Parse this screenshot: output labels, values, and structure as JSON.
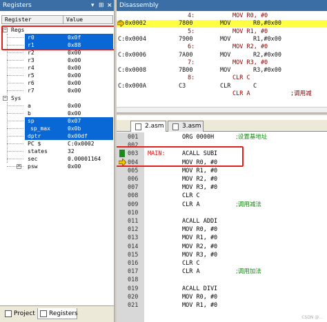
{
  "registers_pane": {
    "title": "Registers",
    "title_controls": [
      "▾",
      "⊞",
      "×"
    ],
    "header": {
      "col1": "Register",
      "col2": "Value"
    },
    "rows": [
      {
        "name": "Regs",
        "value": "",
        "expander": "−",
        "group": true
      },
      {
        "name": "r0",
        "value": "0x0f",
        "selected": true
      },
      {
        "name": "r1",
        "value": "0x88",
        "selected": true
      },
      {
        "name": "r2",
        "value": "0x00"
      },
      {
        "name": "r3",
        "value": "0x00"
      },
      {
        "name": "r4",
        "value": "0x00"
      },
      {
        "name": "r5",
        "value": "0x00"
      },
      {
        "name": "r6",
        "value": "0x00"
      },
      {
        "name": "r7",
        "value": "0x00"
      },
      {
        "name": "Sys",
        "value": "",
        "expander": "−",
        "group": true
      },
      {
        "name": "a",
        "value": "0x00"
      },
      {
        "name": "b",
        "value": "0x00"
      },
      {
        "name": "sp",
        "value": "0x07",
        "selected": true
      },
      {
        "name": "sp_max",
        "value": "0x0b",
        "selected": true
      },
      {
        "name": "dptr",
        "value": "0x00df",
        "selected": true
      },
      {
        "name": "PC  $",
        "value": "C:0x0002"
      },
      {
        "name": "states",
        "value": "32"
      },
      {
        "name": "sec",
        "value": "0.00001164"
      },
      {
        "name": "psw",
        "value": "0x00",
        "expander": "+"
      }
    ],
    "bottom_tabs": [
      {
        "label": "Project"
      },
      {
        "label": "Registers"
      }
    ]
  },
  "disassembly_pane": {
    "title": "Disassembly",
    "lines": [
      {
        "kind": "src",
        "num": "4:",
        "text": "MOV R0, #0"
      },
      {
        "kind": "asm",
        "addr": "C:0x0002",
        "op": "7800",
        "mn": "MOV",
        "args": "R0,#0x00",
        "current": true
      },
      {
        "kind": "src",
        "num": "5:",
        "text": "MOV R1, #0"
      },
      {
        "kind": "asm",
        "addr": "C:0x0004",
        "op": "7900",
        "mn": "MOV",
        "args": "R1,#0x00"
      },
      {
        "kind": "src",
        "num": "6:",
        "text": "MOV R2, #0"
      },
      {
        "kind": "asm",
        "addr": "C:0x0006",
        "op": "7A00",
        "mn": "MOV",
        "args": "R2,#0x00"
      },
      {
        "kind": "src",
        "num": "7:",
        "text": "MOV R3, #0"
      },
      {
        "kind": "asm",
        "addr": "C:0x0008",
        "op": "7B00",
        "mn": "MOV",
        "args": "R3,#0x00"
      },
      {
        "kind": "src",
        "num": "8:",
        "text": "CLR C"
      },
      {
        "kind": "asm",
        "addr": "C:0x000A",
        "op": "C3",
        "mn": "CLR",
        "args": "C"
      },
      {
        "kind": "src",
        "num": "",
        "text": "CLR A",
        "comment": ";调用减"
      }
    ]
  },
  "editor_pane": {
    "tabs": [
      {
        "label": "2.asm",
        "active": true
      },
      {
        "label": "3.asm",
        "active": false
      }
    ],
    "lines": [
      {
        "num": "001",
        "label": "",
        "code": "ORG 0000H",
        "comment": ";设置基地址"
      },
      {
        "num": "002",
        "label": "",
        "code": "",
        "comment": ""
      },
      {
        "num": "003",
        "label": "MAIN:",
        "code": "ACALL SUBI",
        "comment": "",
        "breakpoint": true
      },
      {
        "num": "004",
        "label": "",
        "code": "MOV R0, #0",
        "comment": "",
        "current": true
      },
      {
        "num": "005",
        "label": "",
        "code": "MOV R1, #0",
        "comment": ""
      },
      {
        "num": "006",
        "label": "",
        "code": "MOV R2, #0",
        "comment": ""
      },
      {
        "num": "007",
        "label": "",
        "code": "MOV R3, #0",
        "comment": ""
      },
      {
        "num": "008",
        "label": "",
        "code": "CLR C",
        "comment": ""
      },
      {
        "num": "009",
        "label": "",
        "code": "CLR A",
        "comment": ";调用减法"
      },
      {
        "num": "010",
        "label": "",
        "code": "",
        "comment": ""
      },
      {
        "num": "011",
        "label": "",
        "code": "ACALL ADDI",
        "comment": ""
      },
      {
        "num": "012",
        "label": "",
        "code": "MOV R0, #0",
        "comment": ""
      },
      {
        "num": "013",
        "label": "",
        "code": "MOV R1, #0",
        "comment": ""
      },
      {
        "num": "014",
        "label": "",
        "code": "MOV R2, #0",
        "comment": ""
      },
      {
        "num": "015",
        "label": "",
        "code": "MOV R3, #0",
        "comment": ""
      },
      {
        "num": "016",
        "label": "",
        "code": "CLR C",
        "comment": ""
      },
      {
        "num": "017",
        "label": "",
        "code": "CLR A",
        "comment": ";调用加法"
      },
      {
        "num": "018",
        "label": "",
        "code": "",
        "comment": ""
      },
      {
        "num": "019",
        "label": "",
        "code": "ACALL DIVI",
        "comment": ""
      },
      {
        "num": "020",
        "label": "",
        "code": "MOV R0, #0",
        "comment": ""
      },
      {
        "num": "021",
        "label": "",
        "code": "MOV R1, #0",
        "comment": ""
      }
    ],
    "watermark": "CSDN @..."
  },
  "colors": {
    "title_bar": "#3a6ea5",
    "selection": "#0a67d6",
    "annotation_red": "#e0201c",
    "current_line": "#ffff44",
    "comment_green": "#108810",
    "label_red": "#e01010",
    "breakpoint_green": "#1a8a1a"
  }
}
